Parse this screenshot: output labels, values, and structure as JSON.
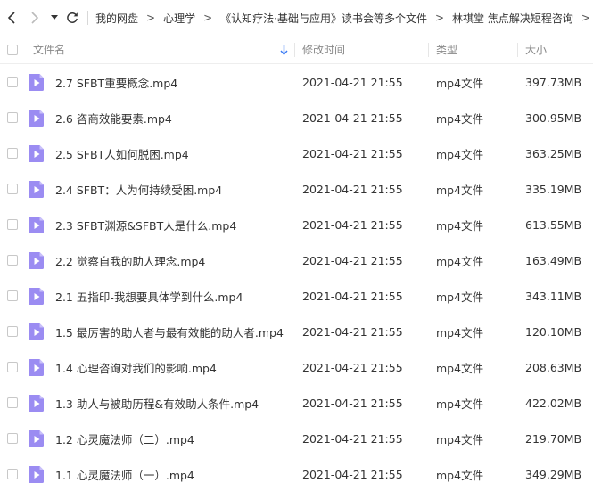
{
  "toolbar": {
    "breadcrumbs": [
      "我的网盘",
      "心理学",
      "《认知疗法·基础与应用》读书会等多个文件",
      "林祺堂 焦点解决短程咨询"
    ],
    "separator": ">"
  },
  "header": {
    "name": "文件名",
    "mtime": "修改时间",
    "type": "类型",
    "size": "大小"
  },
  "colors": {
    "icon": "#9b8cf2",
    "sort_arrow": "#3b7bf5"
  },
  "files": [
    {
      "name": "2.7 SFBT重要概念.mp4",
      "mtime": "2021-04-21 21:55",
      "type": "mp4文件",
      "size": "397.73MB"
    },
    {
      "name": "2.6 咨商效能要素.mp4",
      "mtime": "2021-04-21 21:55",
      "type": "mp4文件",
      "size": "300.95MB"
    },
    {
      "name": "2.5 SFBT人如何脱困.mp4",
      "mtime": "2021-04-21 21:55",
      "type": "mp4文件",
      "size": "363.25MB"
    },
    {
      "name": "2.4 SFBT：人为何持续受困.mp4",
      "mtime": "2021-04-21 21:55",
      "type": "mp4文件",
      "size": "335.19MB"
    },
    {
      "name": "2.3 SFBT渊源&SFBT人是什么.mp4",
      "mtime": "2021-04-21 21:55",
      "type": "mp4文件",
      "size": "613.55MB"
    },
    {
      "name": "2.2 觉察自我的助人理念.mp4",
      "mtime": "2021-04-21 21:55",
      "type": "mp4文件",
      "size": "163.49MB"
    },
    {
      "name": "2.1 五指印-我想要具体学到什么.mp4",
      "mtime": "2021-04-21 21:55",
      "type": "mp4文件",
      "size": "343.11MB"
    },
    {
      "name": "1.5 最厉害的助人者与最有效能的助人者.mp4",
      "mtime": "2021-04-21 21:55",
      "type": "mp4文件",
      "size": "120.10MB"
    },
    {
      "name": "1.4 心理咨询对我们的影响.mp4",
      "mtime": "2021-04-21 21:55",
      "type": "mp4文件",
      "size": "208.63MB"
    },
    {
      "name": "1.3 助人与被助历程&有效助人条件.mp4",
      "mtime": "2021-04-21 21:55",
      "type": "mp4文件",
      "size": "422.02MB"
    },
    {
      "name": "1.2 心灵魔法师（二）.mp4",
      "mtime": "2021-04-21 21:55",
      "type": "mp4文件",
      "size": "219.70MB"
    },
    {
      "name": "1.1 心灵魔法师（一）.mp4",
      "mtime": "2021-04-21 21:55",
      "type": "mp4文件",
      "size": "349.29MB"
    }
  ]
}
